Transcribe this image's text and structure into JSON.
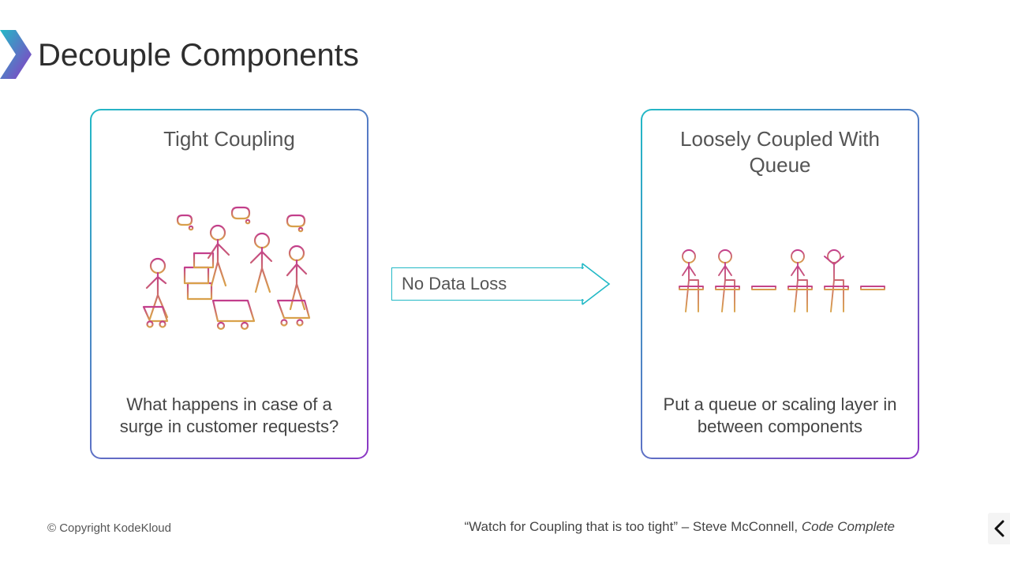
{
  "title": "Decouple Components",
  "left_card": {
    "title": "Tight Coupling",
    "caption": "What happens in case of a surge in customer requests?"
  },
  "right_card": {
    "title": "Loosely Coupled With Queue",
    "caption": "Put a queue or scaling layer in between components"
  },
  "arrow_label": "No Data Loss",
  "copyright": "© Copyright KodeKloud",
  "quote": {
    "text": "“Watch for Coupling that is too tight” – Steve McConnell, ",
    "book": "Code Complete"
  },
  "colors": {
    "teal": "#22b9c6",
    "purple": "#8d37c4",
    "magenta": "#c23d8d",
    "orange": "#d9a24a"
  },
  "icons": {
    "title_chevron": "chevron-right",
    "pager_prev": "chevron-left",
    "left_illustration": "crowd-shopping",
    "right_illustration": "people-seated-queue"
  }
}
